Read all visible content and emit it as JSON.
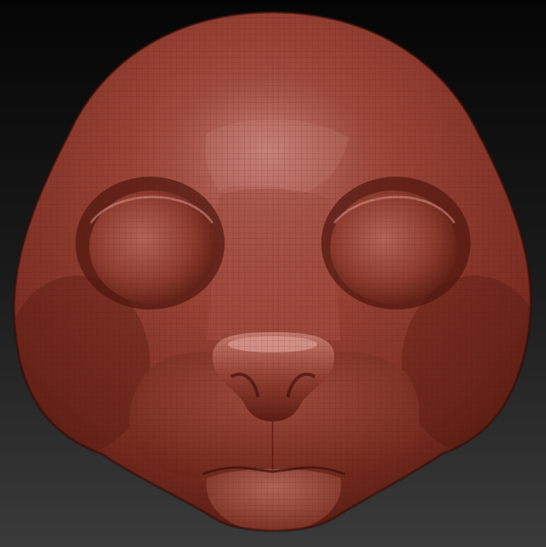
{
  "viewport": {
    "background_top": "#050505",
    "background_bottom": "#3a3a3a"
  },
  "model": {
    "subject": "sculpted-animal-head",
    "material_base": "#8e3a2b",
    "material_highlight": "#c97f72",
    "material_shadow": "#3b120b",
    "wire_color": "#5a1f15"
  }
}
